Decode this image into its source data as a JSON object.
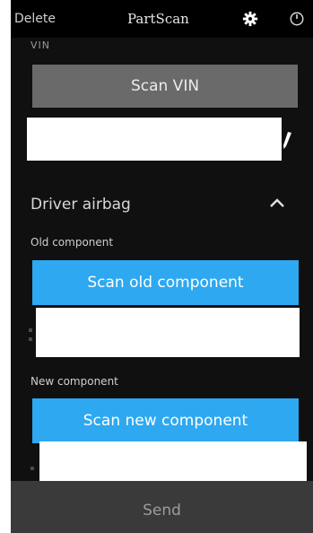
{
  "topbar": {
    "delete_label": "Delete",
    "title": "PartScan",
    "settings_icon": "gear-icon",
    "power_icon": "power-icon"
  },
  "vin": {
    "section_label": "VIN",
    "scan_button": "Scan VIN",
    "value": "",
    "edit_icon": "pencil-icon"
  },
  "component_section": {
    "title": "Driver airbag",
    "toggle_icon": "chevron-up-icon",
    "old_component": {
      "label": "Old component",
      "scan_button": "Scan old component",
      "value": ""
    },
    "new_component": {
      "label": "New component",
      "scan_button": "Scan new component",
      "value": ""
    }
  },
  "footer": {
    "send_label": "Send"
  },
  "colors": {
    "screen_bg": "#101010",
    "topbar_bg": "#000000",
    "scan_vin_bg": "#6a6a6a",
    "accent_blue": "#2ea8f0",
    "send_bar_bg": "#3a3a3a"
  }
}
